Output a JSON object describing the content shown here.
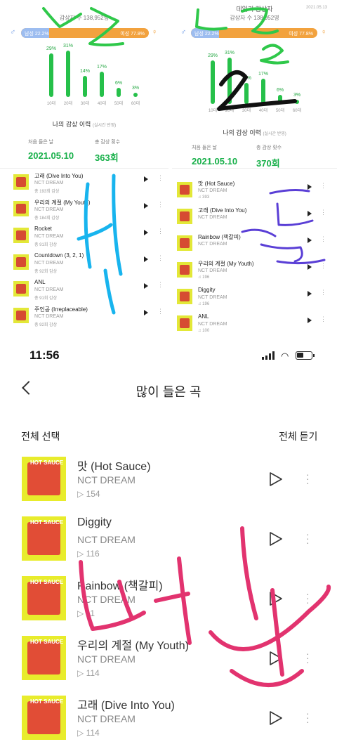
{
  "stats_left": {
    "daily_listeners": "감상자 수 138,952명",
    "male_label": "남성 22.2%",
    "female_label": "여성 77.8%",
    "male_fraction": 0.222,
    "bars": [
      {
        "age": "10대",
        "pct": "29%",
        "value": 29
      },
      {
        "age": "20대",
        "pct": "31%",
        "value": 31
      },
      {
        "age": "30대",
        "pct": "14%",
        "value": 14
      },
      {
        "age": "40대",
        "pct": "17%",
        "value": 17
      },
      {
        "age": "50대",
        "pct": "6%",
        "value": 6
      },
      {
        "age": "60대",
        "pct": "3%",
        "value": 3
      }
    ],
    "history_title": "나의 감상 이력",
    "history_note": "(실시간 반영)",
    "first_label": "처음 들은 날",
    "count_label": "총 감상 횟수",
    "first_date": "2021.05.10",
    "count": "363회"
  },
  "stats_right": {
    "title": "데일리 감상자",
    "date": "2021.05.13",
    "daily_listeners": "감상자 수 138,952명",
    "male_label": "남성 22.2%",
    "female_label": "여성 77.8%",
    "male_fraction": 0.222,
    "bars": [
      {
        "age": "10대",
        "pct": "29%",
        "value": 29
      },
      {
        "age": "20대",
        "pct": "31%",
        "value": 31
      },
      {
        "age": "30대",
        "pct": "14%",
        "value": 14
      },
      {
        "age": "40대",
        "pct": "17%",
        "value": 17
      },
      {
        "age": "50대",
        "pct": "6%",
        "value": 6
      },
      {
        "age": "60대",
        "pct": "3%",
        "value": 3
      }
    ],
    "history_title": "나의 감상 이력",
    "history_note": "(실시간 반영)",
    "first_label": "처음 들은 날",
    "count_label": "총 감상 횟수",
    "first_date": "2021.05.10",
    "count": "370회"
  },
  "grid_left": [
    {
      "title": "고래 (Dive Into You)",
      "artist": "NCT DREAM",
      "count": "총 193회 감상"
    },
    {
      "title": "우리의 계절 (My Youth)",
      "artist": "NCT DREAM",
      "count": "총 184회 감상"
    },
    {
      "title": "Rocket",
      "artist": "NCT DREAM",
      "count": "총 91회 감상"
    },
    {
      "title": "Countdown (3, 2, 1)",
      "artist": "NCT DREAM",
      "count": "총 92회 감상"
    },
    {
      "title": "ANL",
      "artist": "NCT DREAM",
      "count": "총 91회 감상"
    },
    {
      "title": "주인공 (Irreplaceable)",
      "artist": "NCT DREAM",
      "count": "총 92회 감상"
    }
  ],
  "grid_right": [
    {
      "title": "맛 (Hot Sauce)",
      "artist": "NCT DREAM",
      "count": "♫ 393"
    },
    {
      "title": "고래 (Dive Into You)",
      "artist": "NCT DREAM",
      "count": ""
    },
    {
      "title": "Rainbow (책갈피)",
      "artist": "NCT DREAM",
      "count": ""
    },
    {
      "title": "우리의 계절 (My Youth)",
      "artist": "NCT DREAM",
      "count": "♫ 196"
    },
    {
      "title": "Diggity",
      "artist": "NCT DREAM",
      "count": "♫ 196"
    },
    {
      "title": "ANL",
      "artist": "NCT DREAM",
      "count": "♫ 100"
    }
  ],
  "status": {
    "time": "11:56"
  },
  "header": {
    "title": "많이 들은 곡",
    "select_all": "전체 선택",
    "listen_all": "전체 듣기"
  },
  "songs": [
    {
      "title": "맛 (Hot Sauce)",
      "artist": "NCT DREAM",
      "count": "▷ 154"
    },
    {
      "title": "Diggity",
      "artist": "NCT DREAM",
      "count": "▷ 116"
    },
    {
      "title": "Rainbow (책갈피)",
      "artist": "NCT DREAM",
      "count": "▷ 11"
    },
    {
      "title": "우리의 계절 (My Youth)",
      "artist": "NCT DREAM",
      "count": "▷ 114"
    },
    {
      "title": "고래 (Dive Into You)",
      "artist": "NCT DREAM",
      "count": "▷ 114"
    }
  ],
  "album_art_text": "HOT SAUCE",
  "colors": {
    "bar_green": "#26c04a",
    "male_blue": "#9dbdf0",
    "female_orange": "#f2a23e",
    "scribble_green": "#2fc84a",
    "scribble_blue": "#18b4ee",
    "scribble_purple": "#5a3fd6",
    "scribble_pink": "#e2336f"
  }
}
